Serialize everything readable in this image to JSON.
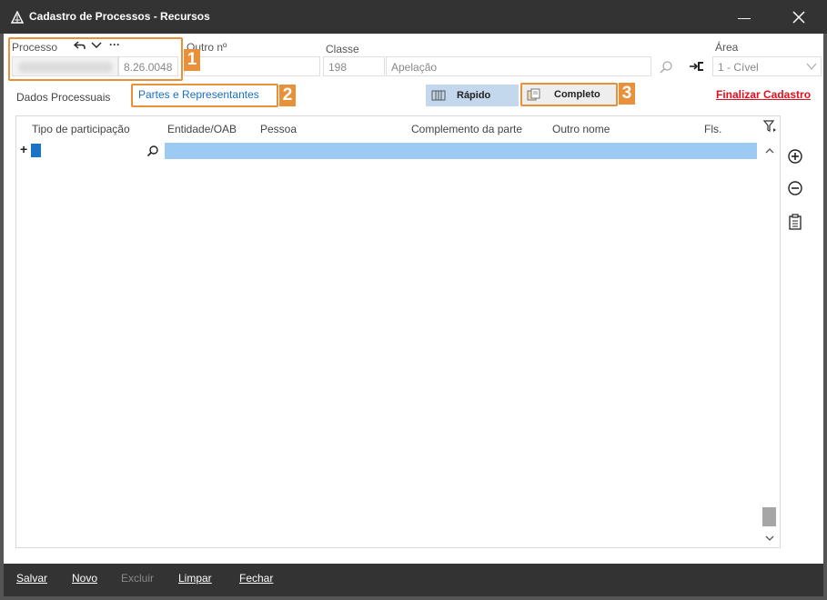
{
  "window": {
    "title": "Cadastro de Processos - Recursos",
    "minimize_glyph": "—",
    "close_glyph": "✕"
  },
  "header": {
    "processo_label": "Processo",
    "processo_value": "8.26.0048",
    "outro_label": "Outro nº",
    "outro_value": "",
    "classe_label": "Classe",
    "classe_code": "198",
    "classe_name": "Apelação",
    "area_label": "Área",
    "area_value": "1 - Cível",
    "more_glyph": "···"
  },
  "callouts": [
    "1",
    "2",
    "3"
  ],
  "tabs": [
    {
      "label": "Dados Processuais",
      "active": false
    },
    {
      "label": "Partes e Representantes",
      "active": true
    }
  ],
  "view_buttons": {
    "rapido": "Rápido",
    "completo": "Completo"
  },
  "finalizar_label": "Finalizar Cadastro",
  "grid": {
    "columns": [
      "Tipo de participação",
      "Entidade/OAB",
      "Pessoa",
      "Complemento da parte",
      "Outro nome",
      "Fls."
    ],
    "add_row_glyph": "+"
  },
  "bottom_bar": {
    "salvar": "Salvar",
    "novo": "Novo",
    "excluir": "Excluir",
    "limpar": "Limpar",
    "fechar": "Fechar"
  },
  "colors": {
    "titlebar": "#333333",
    "accent_orange": "#e8913a",
    "selected_row": "#9ccaf2",
    "link_blue": "#1a6fc9",
    "finalizar_red": "#e0101e"
  }
}
